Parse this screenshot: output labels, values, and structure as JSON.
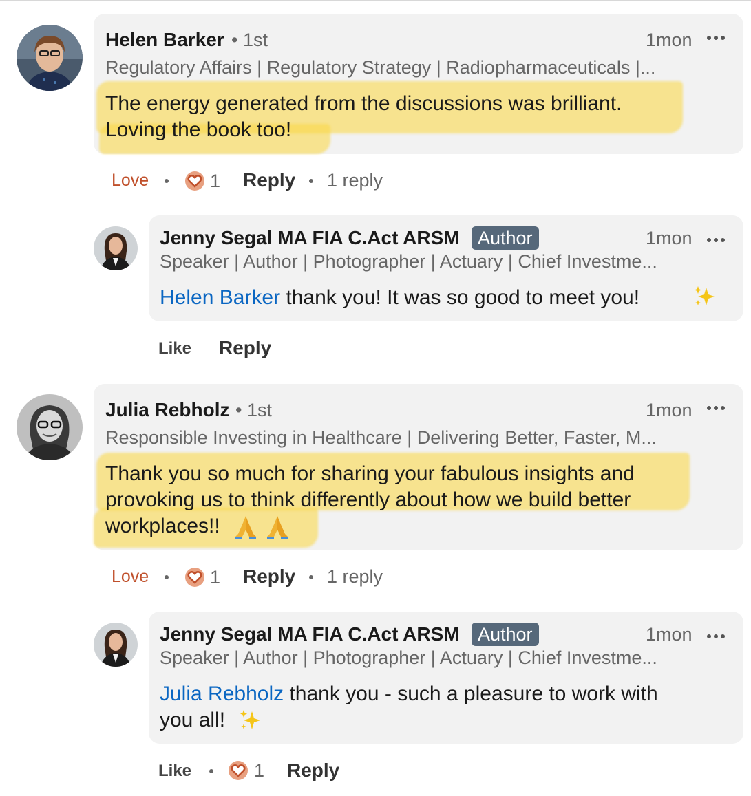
{
  "comments": [
    {
      "name": "Helen Barker",
      "degree": "• 1st",
      "headline": "Regulatory Affairs | Regulatory Strategy | Radiopharmaceuticals |...",
      "time": "1mon",
      "text_line1": "The energy generated from the discussions was brilliant.",
      "text_line2": "Loving the book too!",
      "love_label": "Love",
      "reaction_count": "1",
      "reply_label": "Reply",
      "replies_label": "1 reply",
      "reply": {
        "name": "Jenny Segal MA FIA C.Act ARSM",
        "badge": "Author",
        "headline": "Speaker | Author | Photographer | Actuary | Chief Investme...",
        "time": "1mon",
        "mention": "Helen Barker",
        "text": " thank you!  It was so good to meet you! ",
        "like_label": "Like",
        "reply_label": "Reply"
      }
    },
    {
      "name": "Julia Rebholz",
      "degree": "• 1st",
      "headline": "Responsible Investing in Healthcare | Delivering Better, Faster, M...",
      "time": "1mon",
      "text_line1": "Thank you so much for sharing your fabulous insights and",
      "text_line2": "provoking us to think differently about how we build better",
      "text_line3": "workplaces!!",
      "love_label": "Love",
      "reaction_count": "1",
      "reply_label": "Reply",
      "replies_label": "1 reply",
      "reply": {
        "name": "Jenny Segal MA FIA C.Act ARSM",
        "badge": "Author",
        "headline": "Speaker | Author | Photographer | Actuary | Chief Investme...",
        "time": "1mon",
        "mention": "Julia Rebholz",
        "text_line1": " thank you - such a pleasure to work with",
        "text_line2": "you all! ",
        "like_label": "Like",
        "reaction_count": "1",
        "reply_label": "Reply"
      }
    }
  ],
  "colors": {
    "highlight": "#fad746",
    "mention": "#0a66c2",
    "love": "#c0502b",
    "author_badge": "#56687a",
    "bubble": "#f2f2f2"
  }
}
